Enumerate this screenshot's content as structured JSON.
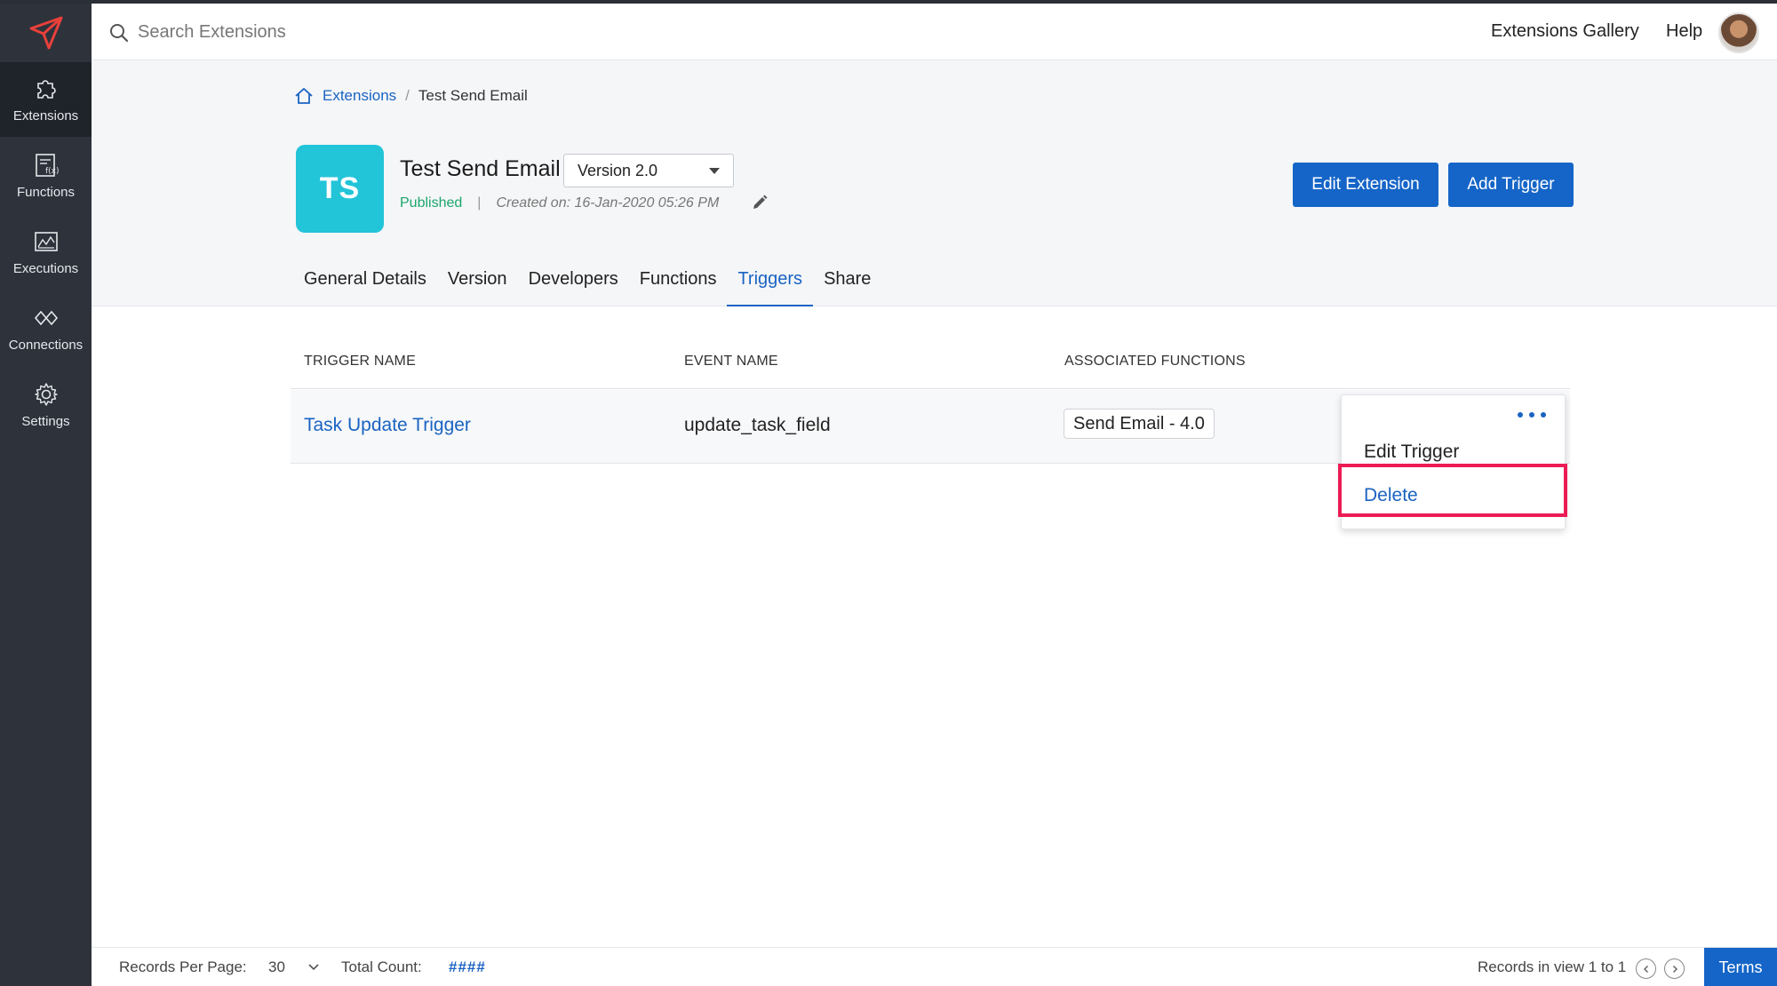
{
  "header": {
    "search_placeholder": "Search Extensions",
    "gallery_link": "Extensions Gallery",
    "help_link": "Help"
  },
  "sidebar": {
    "items": [
      {
        "label": "Extensions",
        "icon": "puzzle-icon",
        "active": true
      },
      {
        "label": "Functions",
        "icon": "function-icon",
        "active": false
      },
      {
        "label": "Executions",
        "icon": "chart-icon",
        "active": false
      },
      {
        "label": "Connections",
        "icon": "connections-icon",
        "active": false
      },
      {
        "label": "Settings",
        "icon": "gear-icon",
        "active": false
      }
    ]
  },
  "breadcrumb": {
    "root": "Extensions",
    "separator": "/",
    "current": "Test Send Email"
  },
  "extension": {
    "initials": "TS",
    "name": "Test Send Email",
    "version": "Version 2.0",
    "status": "Published",
    "meta_separator": "|",
    "created": "Created on: 16-Jan-2020 05:26 PM"
  },
  "actions": {
    "edit_extension": "Edit Extension",
    "add_trigger": "Add Trigger"
  },
  "tabs": [
    {
      "label": "General Details",
      "active": false
    },
    {
      "label": "Version",
      "active": false
    },
    {
      "label": "Developers",
      "active": false
    },
    {
      "label": "Functions",
      "active": false
    },
    {
      "label": "Triggers",
      "active": true
    },
    {
      "label": "Share",
      "active": false
    }
  ],
  "table": {
    "columns": [
      "TRIGGER NAME",
      "EVENT NAME",
      "ASSOCIATED FUNCTIONS"
    ],
    "rows": [
      {
        "trigger_name": "Task Update Trigger",
        "event_name": "update_task_field",
        "function": "Send Email  -  4.0"
      }
    ]
  },
  "menu": {
    "items": [
      "Edit Trigger",
      "Delete"
    ]
  },
  "footer": {
    "records_per_page_label": "Records Per Page:",
    "records_per_page_value": "30",
    "total_count_label": "Total Count:",
    "total_count_value": "####",
    "records_in_view": "Records in view 1 to 1",
    "terms": "Terms"
  },
  "colors": {
    "brand_blue": "#1565c8",
    "link_blue": "#1a63c2",
    "sidebar_bg": "#2d323b",
    "avatar_teal": "#22c4d8",
    "published_green": "#1aa66b",
    "highlight_red": "#ec1b55"
  }
}
